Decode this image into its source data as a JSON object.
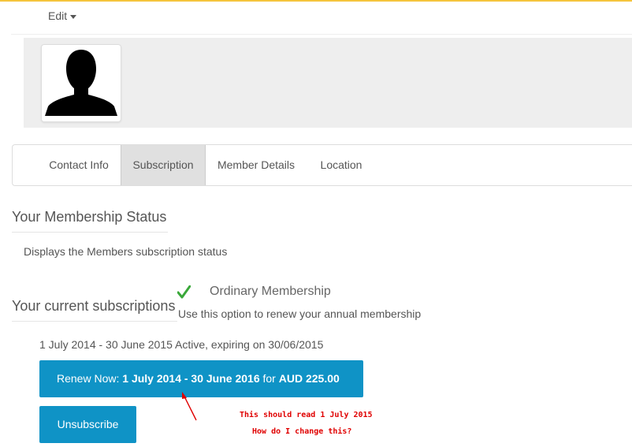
{
  "toolbar": {
    "edit_label": "Edit"
  },
  "tabs": [
    {
      "label": "Contact Info",
      "active": false
    },
    {
      "label": "Subscription",
      "active": true
    },
    {
      "label": "Member Details",
      "active": false
    },
    {
      "label": "Location",
      "active": false
    }
  ],
  "membership_status": {
    "title": "Your Membership Status",
    "description": "Displays the Members subscription status"
  },
  "subscriptions": {
    "title": "Your current subscriptions",
    "option_title": "Ordinary Membership",
    "option_description": "Use this option to renew your annual membership",
    "active_line": "1 July 2014 - 30 June 2015 Active, expiring on 30/06/2015",
    "renew_button": {
      "prefix": "Renew Now: ",
      "period": "1 July 2014 - 30 June 2016",
      "middle": " for ",
      "price": "AUD 225.00"
    },
    "unsubscribe_label": "Unsubscribe"
  },
  "annotation": {
    "line1": "This should read 1 July 2015",
    "line2": "How do I change this?"
  },
  "colors": {
    "accent_button": "#0f93c6",
    "check": "#3aa83a",
    "annotation": "#e00000",
    "top_border": "#f5c43c"
  },
  "icons": {
    "edit_caret": "caret-down-icon",
    "status": "checkmark-icon",
    "avatar": "person-silhouette-icon"
  }
}
